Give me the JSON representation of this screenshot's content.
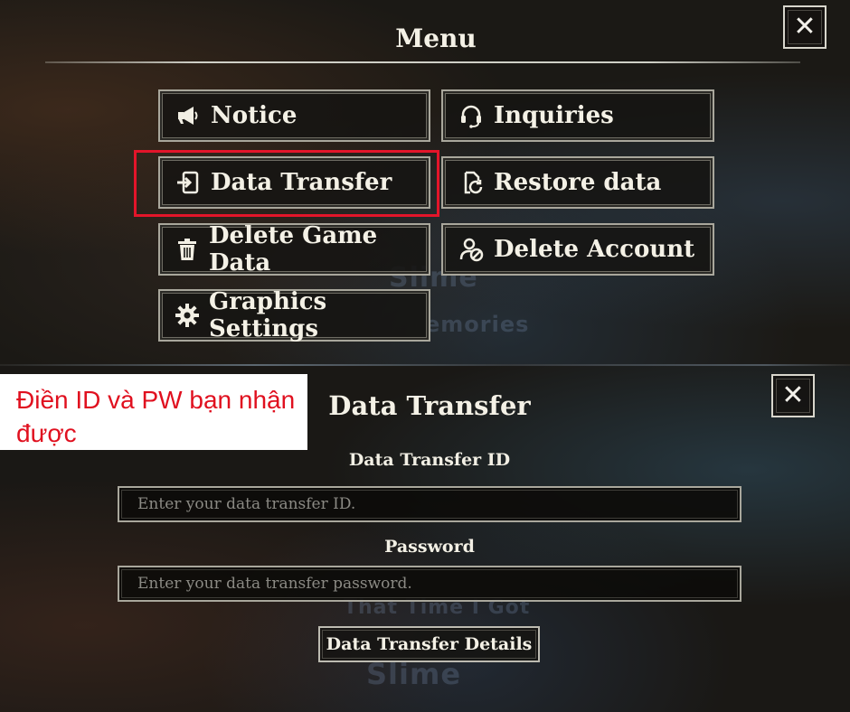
{
  "menu": {
    "title": "Menu",
    "close_label": "✕",
    "buttons": {
      "notice": {
        "label": "Notice",
        "icon": "megaphone-icon"
      },
      "inquiries": {
        "label": "Inquiries",
        "icon": "headset-icon"
      },
      "data_transfer": {
        "label": "Data Transfer",
        "icon": "transfer-in-icon"
      },
      "restore_data": {
        "label": "Restore data",
        "icon": "restore-icon"
      },
      "delete_game_data": {
        "label": "Delete Game Data",
        "icon": "trash-icon"
      },
      "delete_account": {
        "label": "Delete Account",
        "icon": "delete-account-icon"
      },
      "graphics_settings": {
        "label": "Graphics Settings",
        "icon": "gear-icon"
      }
    },
    "highlight_color": "#e3152a"
  },
  "annotation": {
    "text": "Điền ID và PW bạn nhận được",
    "color": "#e0101f"
  },
  "data_transfer_dialog": {
    "title": "Data Transfer",
    "close_label": "✕",
    "id_label": "Data Transfer ID",
    "id_placeholder": "Enter your data transfer ID.",
    "password_label": "Password",
    "password_placeholder": "Enter your data transfer password.",
    "details_button": "Data Transfer Details"
  }
}
